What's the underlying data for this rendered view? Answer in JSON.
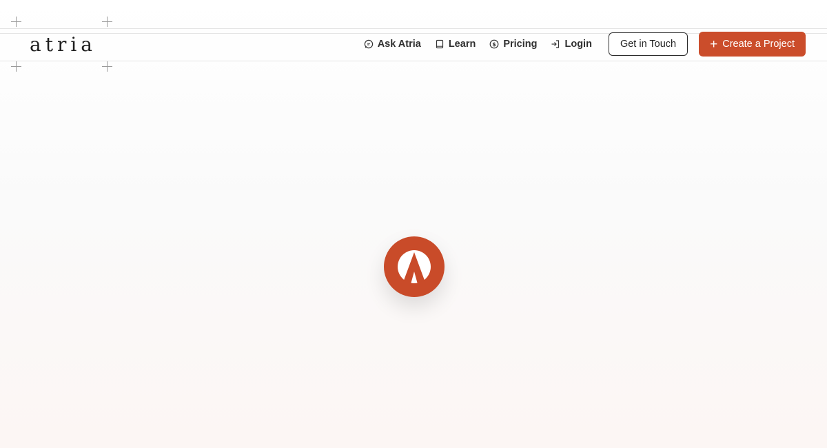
{
  "brand": {
    "logo_text": "atria",
    "accent_color": "#cb4d2b"
  },
  "nav": {
    "items": [
      {
        "label": "Ask Atria",
        "icon": "chat-bubble-icon"
      },
      {
        "label": "Learn",
        "icon": "book-icon"
      },
      {
        "label": "Pricing",
        "icon": "dollar-circle-icon"
      },
      {
        "label": "Login",
        "icon": "login-arrow-icon"
      }
    ],
    "get_in_touch_label": "Get in Touch",
    "create_project_label": "Create a Project",
    "create_project_icon": "plus-icon"
  },
  "loader": {
    "icon": "atria-logo-mark-icon"
  }
}
